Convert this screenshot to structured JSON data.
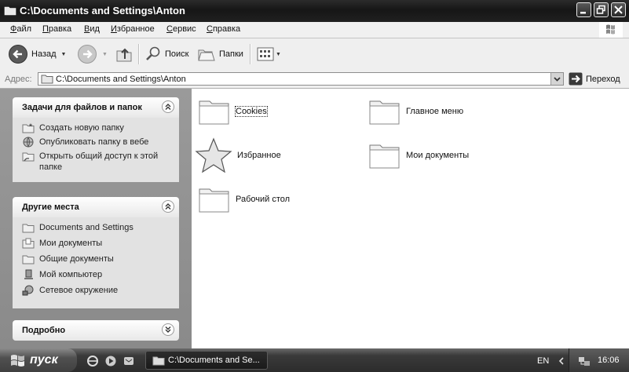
{
  "window": {
    "title": "C:\\Documents and Settings\\Anton",
    "controls": [
      "minimize-icon",
      "restore-icon",
      "close-icon"
    ]
  },
  "menu": [
    {
      "underline": "Ф",
      "rest": "айл"
    },
    {
      "underline": "П",
      "rest": "равка"
    },
    {
      "underline": "В",
      "rest": "ид"
    },
    {
      "underline": "И",
      "rest": "збранное"
    },
    {
      "underline": "С",
      "rest": "ервис"
    },
    {
      "underline": "С",
      "rest": "правка"
    }
  ],
  "toolbar": {
    "back_label": "Назад",
    "search_label": "Поиск",
    "folders_label": "Папки"
  },
  "address": {
    "label": "Адрес:",
    "value": "C:\\Documents and Settings\\Anton",
    "go_label": "Переход"
  },
  "sidepane": {
    "tasks": {
      "title": "Задачи для файлов и папок",
      "items": [
        {
          "label": "Создать новую папку",
          "icon": "new-folder-icon"
        },
        {
          "label": "Опубликовать папку в вебе",
          "icon": "globe-icon"
        },
        {
          "label": "Открыть общий доступ к этой папке",
          "icon": "share-folder-icon"
        }
      ]
    },
    "places": {
      "title": "Другие места",
      "items": [
        {
          "label": "Documents and Settings",
          "icon": "folder-icon"
        },
        {
          "label": "Мои документы",
          "icon": "my-documents-icon"
        },
        {
          "label": "Общие документы",
          "icon": "folder-icon"
        },
        {
          "label": "Мой компьютер",
          "icon": "computer-icon"
        },
        {
          "label": "Сетевое окружение",
          "icon": "network-icon"
        }
      ]
    },
    "details": {
      "title": "Подробно"
    }
  },
  "files": [
    {
      "name": "Cookies",
      "icon": "folder-icon",
      "focused": true
    },
    {
      "name": "Главное меню",
      "icon": "folder-icon"
    },
    {
      "name": "Избранное",
      "icon": "star-icon"
    },
    {
      "name": "Мои документы",
      "icon": "folder-icon"
    },
    {
      "name": "Рабочий стол",
      "icon": "folder-icon"
    }
  ],
  "taskbar": {
    "start_label": "пуск",
    "task_label": "C:\\Documents and Se...",
    "lang": "EN",
    "clock": "16:06"
  }
}
